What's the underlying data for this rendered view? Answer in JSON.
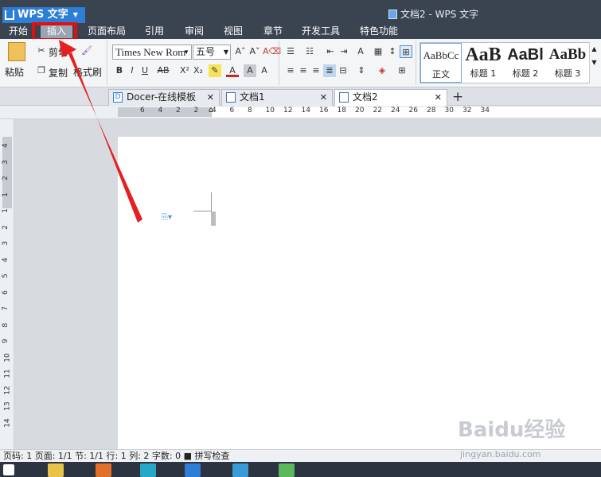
{
  "app": {
    "name": "WPS 文字",
    "window_title": "文档2 - WPS 文字"
  },
  "menu_tabs": [
    "开始",
    "插入",
    "页面布局",
    "引用",
    "审阅",
    "视图",
    "章节",
    "开发工具",
    "特色功能"
  ],
  "ribbon": {
    "clipboard": {
      "paste": "粘贴",
      "cut": "剪切",
      "copy": "复制",
      "format_painter": "格式刷"
    },
    "font": {
      "family": "Times New Roman",
      "size": "五号"
    },
    "styles": [
      {
        "sample": "AaBbCc",
        "label": "正文"
      },
      {
        "sample": "AaB",
        "label": "标题 1"
      },
      {
        "sample": "AaBl",
        "label": "标题 2"
      },
      {
        "sample": "AaBb",
        "label": "标题 3"
      }
    ]
  },
  "doc_tabs": [
    "Docer-在线模板",
    "文档1",
    "文档2"
  ],
  "ruler": {
    "h_ticks": [
      "6",
      "4",
      "2",
      "2",
      "4",
      "6",
      "8",
      "10",
      "12",
      "14",
      "16",
      "18",
      "20",
      "22",
      "24",
      "26",
      "28",
      "30",
      "32",
      "34"
    ],
    "v_ticks": [
      "4",
      "3",
      "2",
      "1",
      "1",
      "2",
      "3",
      "4",
      "5",
      "6",
      "7",
      "8",
      "9",
      "10",
      "11",
      "12",
      "13",
      "14"
    ]
  },
  "status": "页码: 1  页面: 1/1  节: 1/1  行: 1  列: 2  字数: 0  ■ 拼写检查",
  "watermark": {
    "main": "Baidu经验",
    "sub": "jingyan.baidu.com"
  },
  "colors": {
    "titlebar": "#3a4350",
    "accent": "#2c7ed6",
    "highlight": "#e01010"
  }
}
